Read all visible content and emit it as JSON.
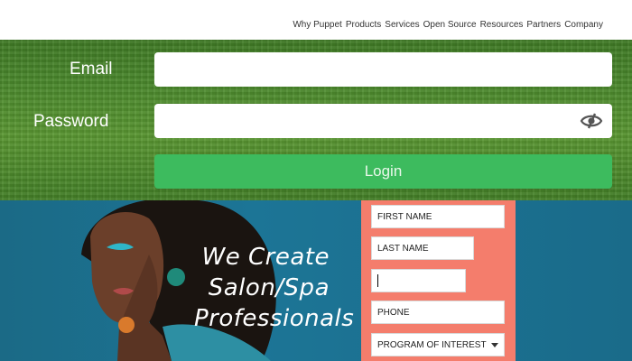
{
  "nav": {
    "links": [
      "Why Puppet",
      "Products",
      "Services",
      "Open Source",
      "Resources",
      "Partners",
      "Company"
    ]
  },
  "login": {
    "email_label": "Email",
    "email_value": "",
    "password_label": "Password",
    "password_value": "",
    "login_button": "Login",
    "icons": {
      "toggle_visibility": "eye-slash-icon"
    }
  },
  "promo": {
    "tagline": [
      "We Create",
      "Salon/Spa",
      "Professionals"
    ],
    "form": {
      "first_name": "FIRST NAME",
      "last_name": "LAST NAME",
      "email_value": "",
      "phone": "PHONE",
      "program": "PROGRAM OF INTEREST"
    }
  },
  "colors": {
    "login_button": "#3dbb5e",
    "promo_background": "#1c7596",
    "form_background": "#f47d6c"
  }
}
